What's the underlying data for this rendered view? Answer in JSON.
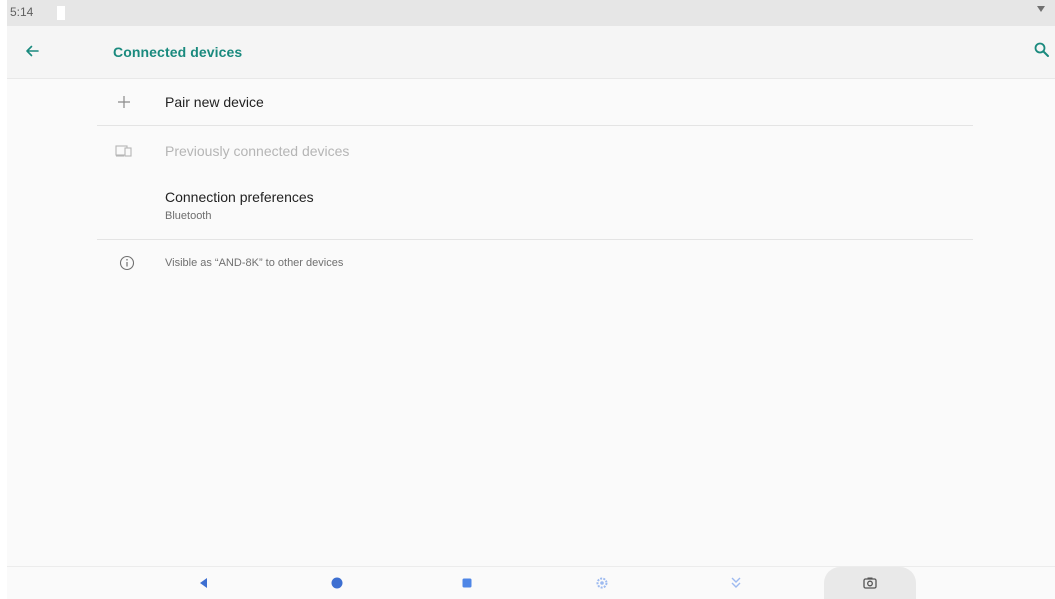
{
  "status_bar": {
    "time": "5:14"
  },
  "app_bar": {
    "title": "Connected devices"
  },
  "list": {
    "pair_new_device": "Pair new device",
    "previously_connected": "Previously connected devices",
    "connection_preferences": {
      "title": "Connection preferences",
      "subtitle": "Bluetooth"
    },
    "visible_as": "Visible as “AND-8K” to other devices"
  },
  "icons": {
    "back": "back-arrow-icon",
    "search": "search-icon",
    "add": "plus-icon",
    "devices": "devices-icon",
    "info": "info-icon"
  },
  "nav_bar": {
    "buttons": [
      "back-triangle-icon",
      "home-circle-icon",
      "recents-square-icon",
      "settings-gear-icon",
      "collapse-chevrons-icon",
      "screenshot-camera-icon"
    ]
  },
  "colors": {
    "accent": "#1a8a7e",
    "background": "#fafafa",
    "status_bar": "#e6e6e6"
  }
}
